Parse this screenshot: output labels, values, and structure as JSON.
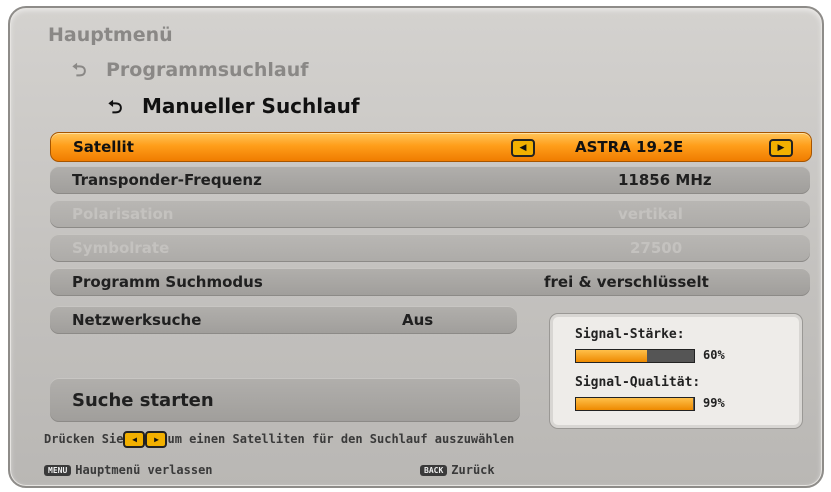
{
  "breadcrumb": {
    "level1": "Hauptmenü",
    "level2": "Programmsuchlauf",
    "level3": "Manueller Suchlauf"
  },
  "rows": {
    "satellite": {
      "label": "Satellit",
      "value": "ASTRA 19.2E"
    },
    "transponder": {
      "label": "Transponder-Frequenz",
      "value": "11856 MHz"
    },
    "polarisation": {
      "label": "Polarisation",
      "value": "vertikal"
    },
    "symbolrate": {
      "label": "Symbolrate",
      "value": "27500"
    },
    "search_mode": {
      "label": "Programm Suchmodus",
      "value": "frei & verschlüsselt"
    },
    "network_search": {
      "label": "Netzwerksuche",
      "value": "Aus"
    },
    "start": {
      "label": "Suche starten"
    }
  },
  "signal": {
    "strength_label": "Signal-Stärke:",
    "strength_value": "60%",
    "strength_level": 0.6,
    "quality_label": "Signal-Qualität:",
    "quality_value": "99%",
    "quality_level": 0.99
  },
  "hint": {
    "prefix": "Drücken Sie",
    "suffix": "um einen Satelliten für den Suchlauf auszuwählen"
  },
  "footer": {
    "menu_key": "MENU",
    "menu_label": "Hauptmenü verlassen",
    "back_key": "BACK",
    "back_label": "Zurück"
  },
  "colors": {
    "highlight": "#f08a00",
    "panel": "#c8c6c3",
    "bar_fill": "#ee8a00"
  }
}
